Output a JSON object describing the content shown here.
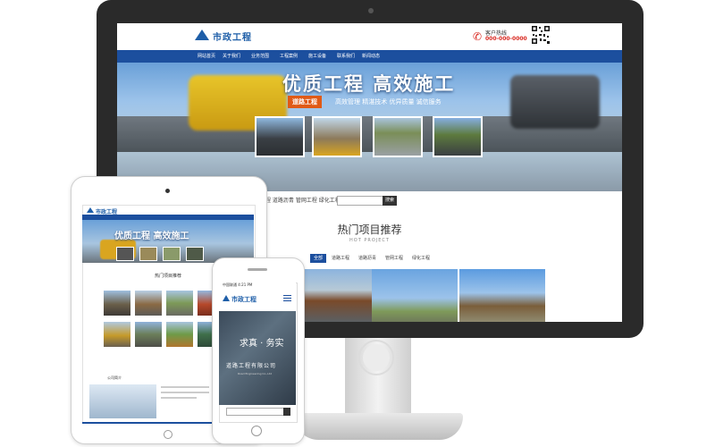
{
  "desktop": {
    "logo_text": "市政工程",
    "phone_label": "客户热线",
    "phone_number": "000-000-0000",
    "nav_items": [
      "网站首页",
      "关于我们",
      "业务范围",
      "工程案例",
      "施工设备",
      "联系我们",
      "新闻动态"
    ],
    "banner_title": "优质工程  高效施工",
    "banner_tag": "道路工程",
    "banner_sub": "高效管理  精湛技术  优异质量  诚信服务",
    "search_links": "路工程  道路沥青  管网工程  绿化工程",
    "search_button": "搜索",
    "section_title": "热门项目推荐",
    "section_sub": "HOT PROJECT",
    "tabs": [
      "全部",
      "道路工程",
      "道路沥青",
      "管网工程",
      "绿化工程"
    ]
  },
  "tablet": {
    "logo_text": "市政工程",
    "banner_title": "优质工程  高效施工",
    "section_title": "热门项目推荐",
    "office_label": "公司简介"
  },
  "phone": {
    "status_text": "中国联通  4:21 PM",
    "logo_text": "市政工程",
    "banner_title": "求真 · 务实",
    "banner_company": "道路工程有限公司",
    "banner_en": "Road Engineering Co.,Ltd"
  },
  "colors": {
    "primary": "#1c4f9e",
    "accent": "#e05a16",
    "phone_red": "#d8271f"
  },
  "icons": [
    "logo-triangle-icon",
    "phone-icon",
    "qr-code-icon",
    "search-icon",
    "camera-icon",
    "home-button-icon"
  ]
}
